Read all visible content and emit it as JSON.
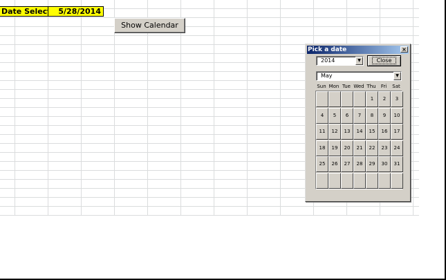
{
  "sheet": {
    "label_cell": "Date Selected",
    "date_cell": "5/28/2014",
    "show_button": "Show Calendar"
  },
  "dialog": {
    "title": "Pick a date",
    "close_x": "×",
    "year": "2014",
    "month": "May",
    "close_button": "Close",
    "dropdown_arrow": "▼",
    "weekdays": [
      "Sun",
      "Mon",
      "Tue",
      "Wed",
      "Thu",
      "Fri",
      "Sat"
    ],
    "weeks": [
      [
        "",
        "",
        "",
        "",
        "1",
        "2",
        "3"
      ],
      [
        "4",
        "5",
        "6",
        "7",
        "8",
        "9",
        "10"
      ],
      [
        "11",
        "12",
        "13",
        "14",
        "15",
        "16",
        "17"
      ],
      [
        "18",
        "19",
        "20",
        "21",
        "22",
        "23",
        "24"
      ],
      [
        "25",
        "26",
        "27",
        "28",
        "29",
        "30",
        "31"
      ],
      [
        "",
        "",
        "",
        "",
        "",
        "",
        ""
      ]
    ]
  }
}
